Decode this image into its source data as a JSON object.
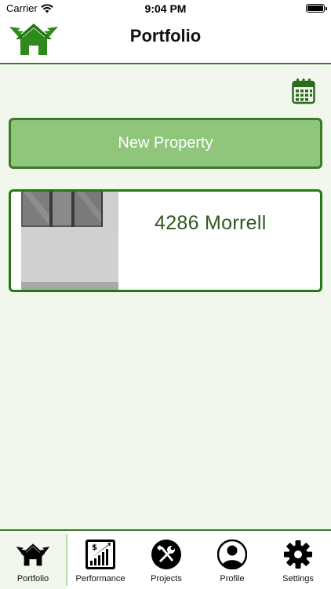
{
  "status_bar": {
    "carrier": "Carrier",
    "time": "9:04 PM"
  },
  "header": {
    "title": "Portfolio",
    "logo_icon": "winged-house-logo"
  },
  "main": {
    "calendar_icon": "calendar-icon",
    "new_property_label": "New Property",
    "properties": [
      {
        "name": "4286 Morrell"
      }
    ]
  },
  "tab_bar": {
    "tabs": [
      {
        "label": "Portfolio",
        "icon": "winged-house-icon",
        "active": true
      },
      {
        "label": "Performance",
        "icon": "chart-dollar-icon",
        "active": false
      },
      {
        "label": "Projects",
        "icon": "tools-icon",
        "active": false
      },
      {
        "label": "Profile",
        "icon": "person-icon",
        "active": false
      },
      {
        "label": "Settings",
        "icon": "gear-icon",
        "active": false
      }
    ]
  },
  "colors": {
    "brand_green": "#3b7a2c",
    "button_fill": "#90c67c",
    "background_tint": "#f1f7ec",
    "property_text": "#2f5a1f"
  }
}
